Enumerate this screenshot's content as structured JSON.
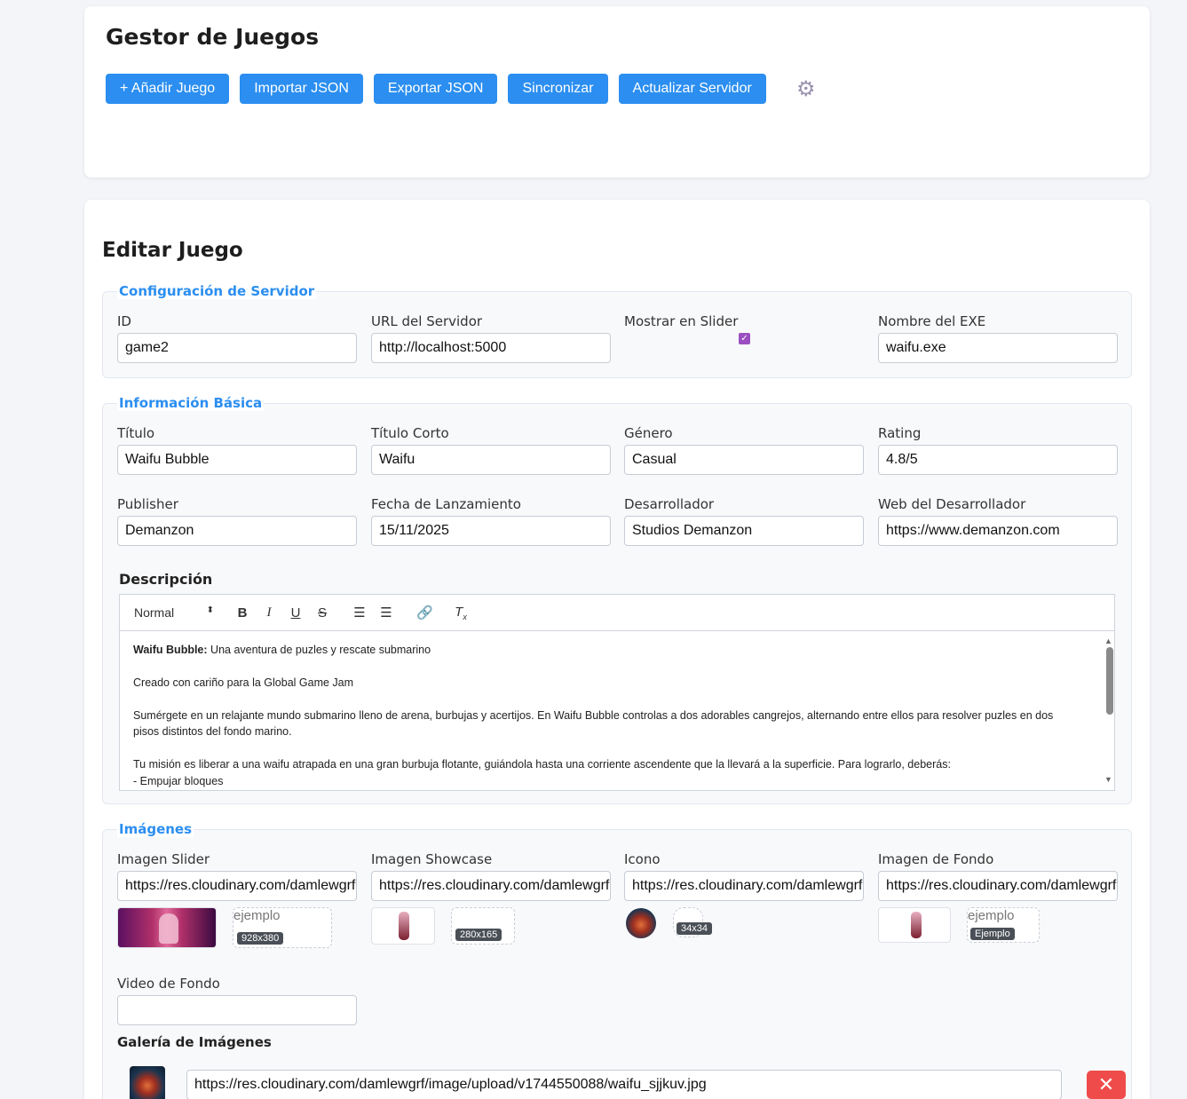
{
  "header": {
    "title": "Gestor de Juegos",
    "buttons": {
      "add": "+ Añadir Juego",
      "import": "Importar JSON",
      "export": "Exportar JSON",
      "sync": "Sincronizar",
      "update_server": "Actualizar Servidor"
    }
  },
  "edit": {
    "title": "Editar Juego",
    "server_config": {
      "legend": "Configuración de Servidor",
      "id_label": "ID",
      "id_value": "game2",
      "server_url_label": "URL del Servidor",
      "server_url_value": "http://localhost:5000",
      "slider_label": "Mostrar en Slider",
      "slider_checked": true,
      "exe_label": "Nombre del EXE",
      "exe_value": "waifu.exe"
    },
    "basic_info": {
      "legend": "Información Básica",
      "title_label": "Título",
      "title_value": "Waifu Bubble",
      "short_title_label": "Título Corto",
      "short_title_value": "Waifu",
      "genre_label": "Género",
      "genre_value": "Casual",
      "rating_label": "Rating",
      "rating_value": "4.8/5",
      "publisher_label": "Publisher",
      "publisher_value": "Demanzon",
      "release_label": "Fecha de Lanzamiento",
      "release_value": "15/11/2025",
      "developer_label": "Desarrollador",
      "developer_value": "Studios Demanzon",
      "dev_web_label": "Web del Desarrollador",
      "dev_web_value": "https://www.demanzon.com",
      "description_label": "Descripción",
      "editor_format": "Normal",
      "description": {
        "p1_bold": "Waifu Bubble:",
        "p1_rest": " Una aventura de puzles y rescate submarino",
        "p2": "Creado con cariño para la Global Game Jam",
        "p3": "Sumérgete en un relajante mundo submarino lleno de arena, burbujas y acertijos. En Waifu Bubble controlas a dos adorables cangrejos, alternando entre ellos para resolver puzles en dos pisos distintos del fondo marino.",
        "p4": "Tu misión es liberar a una waifu atrapada en una gran burbuja flotante, guiándola hasta una corriente ascendente que la llevará a la superficie. Para lograrlo, deberás:",
        "p5": "- Empujar bloques"
      }
    },
    "images": {
      "legend": "Imágenes",
      "slider_label": "Imagen Slider",
      "slider_value": "https://res.cloudinary.com/damlewgrf",
      "showcase_label": "Imagen Showcase",
      "showcase_value": "https://res.cloudinary.com/damlewgrf",
      "icon_label": "Icono",
      "icon_value": "https://res.cloudinary.com/damlewgrf",
      "bg_label": "Imagen de Fondo",
      "bg_value": "https://res.cloudinary.com/damlewgrf",
      "example_alt": "ejemplo",
      "slider_size": "928x380",
      "showcase_size": "280x165",
      "icon_size": "34x34",
      "bg_badge": "Ejemplo",
      "video_label": "Video de Fondo",
      "video_value": "",
      "gallery_label": "Galería de Imágenes",
      "gallery_url": "https://res.cloudinary.com/damlewgrf/image/upload/v1744550088/waifu_sjjkuv.jpg"
    }
  }
}
